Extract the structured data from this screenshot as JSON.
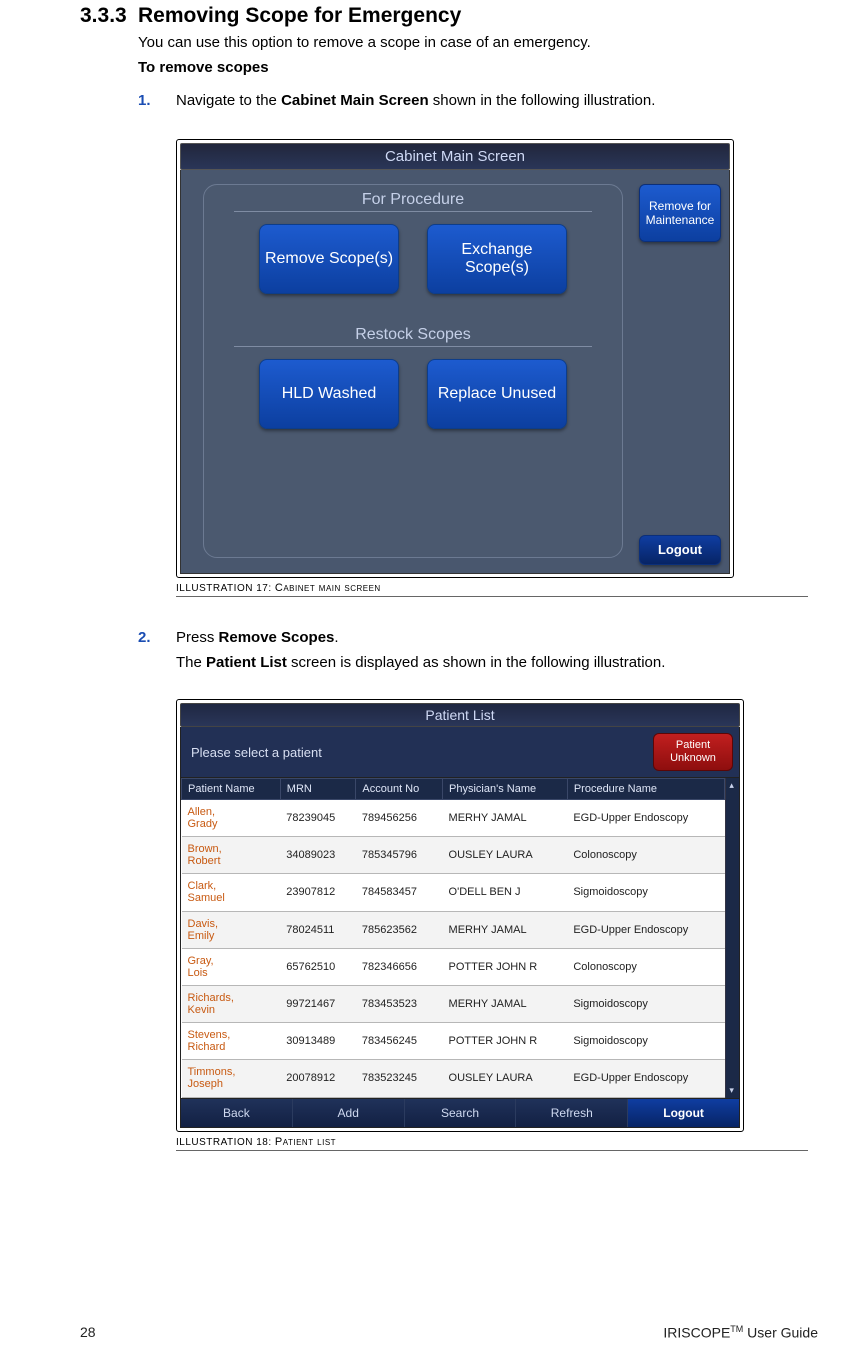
{
  "section": {
    "number": "3.3.3",
    "title": "Removing Scope for Emergency",
    "intro": "You can use this option to remove a scope in case of an emergency.",
    "subhead": "To remove scopes"
  },
  "steps": {
    "s1": {
      "num": "1.",
      "pre": "Navigate to the ",
      "bold": "Cabinet Main Screen",
      "post": " shown in the following illustration."
    },
    "s2": {
      "num": "2.",
      "pre": "Press ",
      "bold": "Remove Scopes",
      "post": ".",
      "follow_pre": "The ",
      "follow_bold": "Patient List",
      "follow_post": " screen is displayed as shown in the following illustration."
    }
  },
  "fig17": {
    "caption_prefix": "Illustration 17: ",
    "caption_text": "Cabinet main screen",
    "title": "Cabinet Main Screen",
    "group1": "For Procedure",
    "btn_remove": "Remove Scope(s)",
    "btn_exchange": "Exchange Scope(s)",
    "group2": "Restock Scopes",
    "btn_hld": "HLD Washed",
    "btn_replace": "Replace Unused",
    "btn_maint": "Remove for Maintenance",
    "btn_logout": "Logout"
  },
  "fig18": {
    "caption_prefix": "Illustration 18: ",
    "caption_text": "Patient list",
    "title": "Patient List",
    "prompt": "Please select a patient",
    "btn_unknown": "Patient Unknown",
    "cols": {
      "c0": "Patient Name",
      "c1": "MRN",
      "c2": "Account No",
      "c3": "Physician's Name",
      "c4": "Procedure Name"
    },
    "rows": [
      {
        "name": "Allen,\nGrady",
        "mrn": "78239045",
        "acct": "789456256",
        "phys": "MERHY JAMAL",
        "proc": "EGD-Upper Endoscopy"
      },
      {
        "name": "Brown,\nRobert",
        "mrn": "34089023",
        "acct": "785345796",
        "phys": "OUSLEY LAURA",
        "proc": "Colonoscopy"
      },
      {
        "name": "Clark,\nSamuel",
        "mrn": "23907812",
        "acct": "784583457",
        "phys": "O'DELL BEN J",
        "proc": "Sigmoidoscopy"
      },
      {
        "name": "Davis,\nEmily",
        "mrn": "78024511",
        "acct": "785623562",
        "phys": "MERHY JAMAL",
        "proc": "EGD-Upper Endoscopy"
      },
      {
        "name": "Gray,\nLois",
        "mrn": "65762510",
        "acct": "782346656",
        "phys": "POTTER JOHN R",
        "proc": "Colonoscopy"
      },
      {
        "name": "Richards,\nKevin",
        "mrn": "99721467",
        "acct": "783453523",
        "phys": "MERHY JAMAL",
        "proc": "Sigmoidoscopy"
      },
      {
        "name": "Stevens,\nRichard",
        "mrn": "30913489",
        "acct": "783456245",
        "phys": "POTTER JOHN R",
        "proc": "Sigmoidoscopy"
      },
      {
        "name": "Timmons,\nJoseph",
        "mrn": "20078912",
        "acct": "783523245",
        "phys": "OUSLEY LAURA",
        "proc": "EGD-Upper Endoscopy"
      }
    ],
    "footer": {
      "back": "Back",
      "add": "Add",
      "search": "Search",
      "refresh": "Refresh",
      "logout": "Logout"
    }
  },
  "pagefoot": {
    "pagenum": "28",
    "product_pre": "IRISCOPE",
    "product_tm": "TM",
    "product_post": " User Guide"
  }
}
